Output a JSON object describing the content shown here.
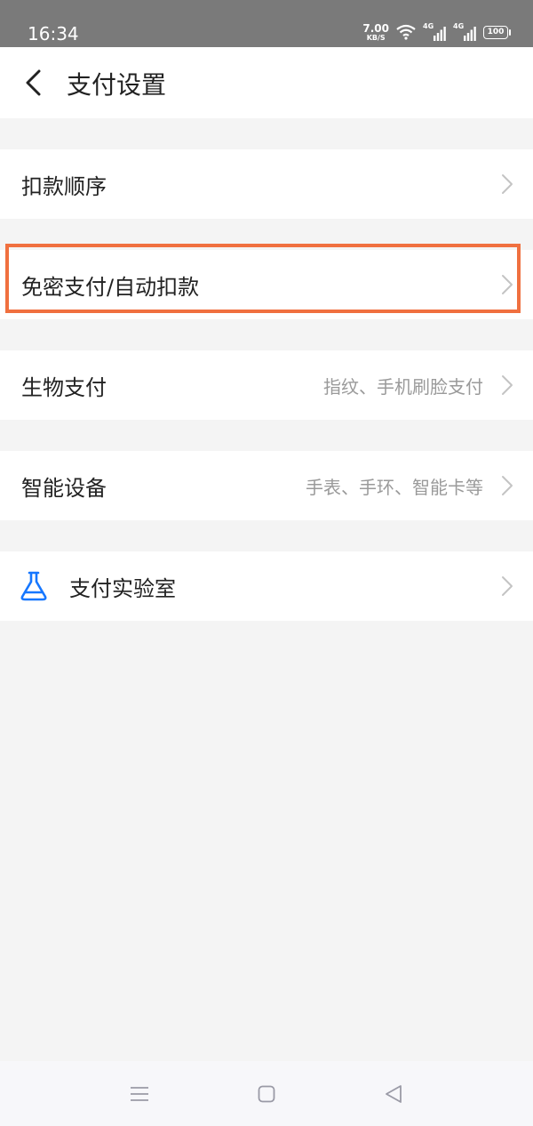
{
  "status_bar": {
    "time": "16:34",
    "net_speed_value": "7.00",
    "net_speed_unit": "KB/S",
    "sim1_label": "4G",
    "sim2_label": "4G",
    "battery": "100"
  },
  "header": {
    "title": "支付设置",
    "back_icon": "chevron-left-icon"
  },
  "settings": [
    {
      "label": "扣款顺序",
      "detail": ""
    },
    {
      "label": "免密支付/自动扣款",
      "detail": ""
    },
    {
      "label": "生物支付",
      "detail": "指纹、手机刷脸支付"
    },
    {
      "label": "智能设备",
      "detail": "手表、手环、智能卡等"
    },
    {
      "label": "支付实验室",
      "detail": "",
      "icon": "flask-icon"
    }
  ],
  "colors": {
    "highlight": "#f0703f",
    "lab_icon": "#1677ff",
    "background": "#f4f4f4",
    "status_bar": "#7a7a7a"
  },
  "system_nav": {
    "menu_icon": "menu-icon",
    "home_icon": "home-icon",
    "back_icon": "back-triangle-icon"
  }
}
